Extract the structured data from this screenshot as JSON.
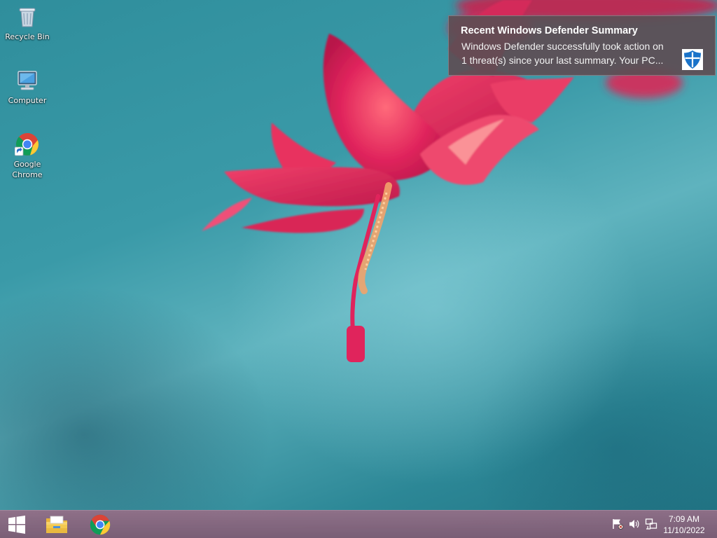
{
  "desktop": {
    "icons": [
      {
        "label": "Recycle Bin",
        "icon": "recycle-bin-icon"
      },
      {
        "label": "Computer",
        "icon": "computer-icon"
      },
      {
        "label": "Google Chrome",
        "icon": "chrome-icon"
      }
    ]
  },
  "notification": {
    "title": "Recent Windows Defender Summary",
    "body": "Windows Defender successfully took action on 1 threat(s) since your last summary. Your PC...",
    "icon": "windows-defender-shield-icon"
  },
  "taskbar": {
    "start_icon": "windows-logo-icon",
    "pinned": [
      {
        "name": "File Explorer",
        "icon": "file-explorer-icon"
      },
      {
        "name": "Google Chrome",
        "icon": "chrome-icon"
      }
    ],
    "tray_icons": [
      "action-center-flag-icon",
      "volume-icon",
      "network-icon"
    ],
    "time": "7:09 AM",
    "date": "11/10/2022"
  },
  "colors": {
    "wallpaper_teal": "#3a9aa8",
    "flower_pink": "#e0245c",
    "toast_background": "#5e4e54",
    "taskbar": "#8c6681",
    "defender_blue": "#1a73c9"
  }
}
